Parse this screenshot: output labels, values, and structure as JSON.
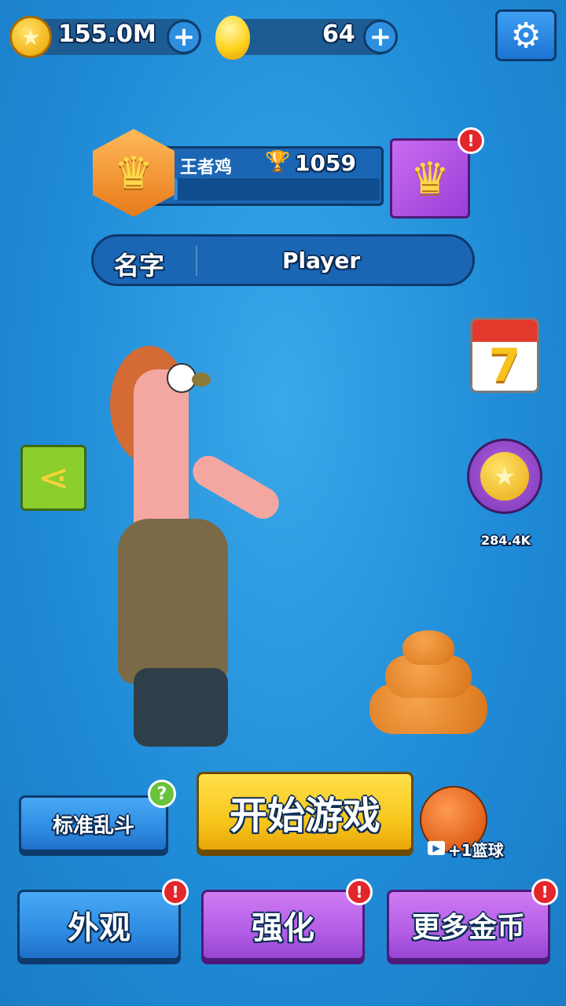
{
  "currency": {
    "stars": "155.0M",
    "gems": "64",
    "plus_label": "+"
  },
  "settings_icon": "gear-icon",
  "rank": {
    "title": "王者鸡",
    "trophies": "1059",
    "progress": 0.02,
    "alert_mark": "!"
  },
  "name_bar": {
    "label": "名字",
    "value": "Player"
  },
  "side": {
    "calendar_day": "7",
    "coin_reward": "284.4K"
  },
  "buttons": {
    "mode": "标准乱斗",
    "mode_help": "?",
    "start": "开始游戏",
    "ball_reward": "+1篮球",
    "skins": "外观",
    "upgrade": "强化",
    "more_coins": "更多金币",
    "alert_mark": "!"
  },
  "colors": {
    "background": "#1f8ad6",
    "start_button": "#f7c51a",
    "blue_button": "#2f8ce2",
    "purple_button": "#b35de6",
    "alert": "#e3262c"
  }
}
